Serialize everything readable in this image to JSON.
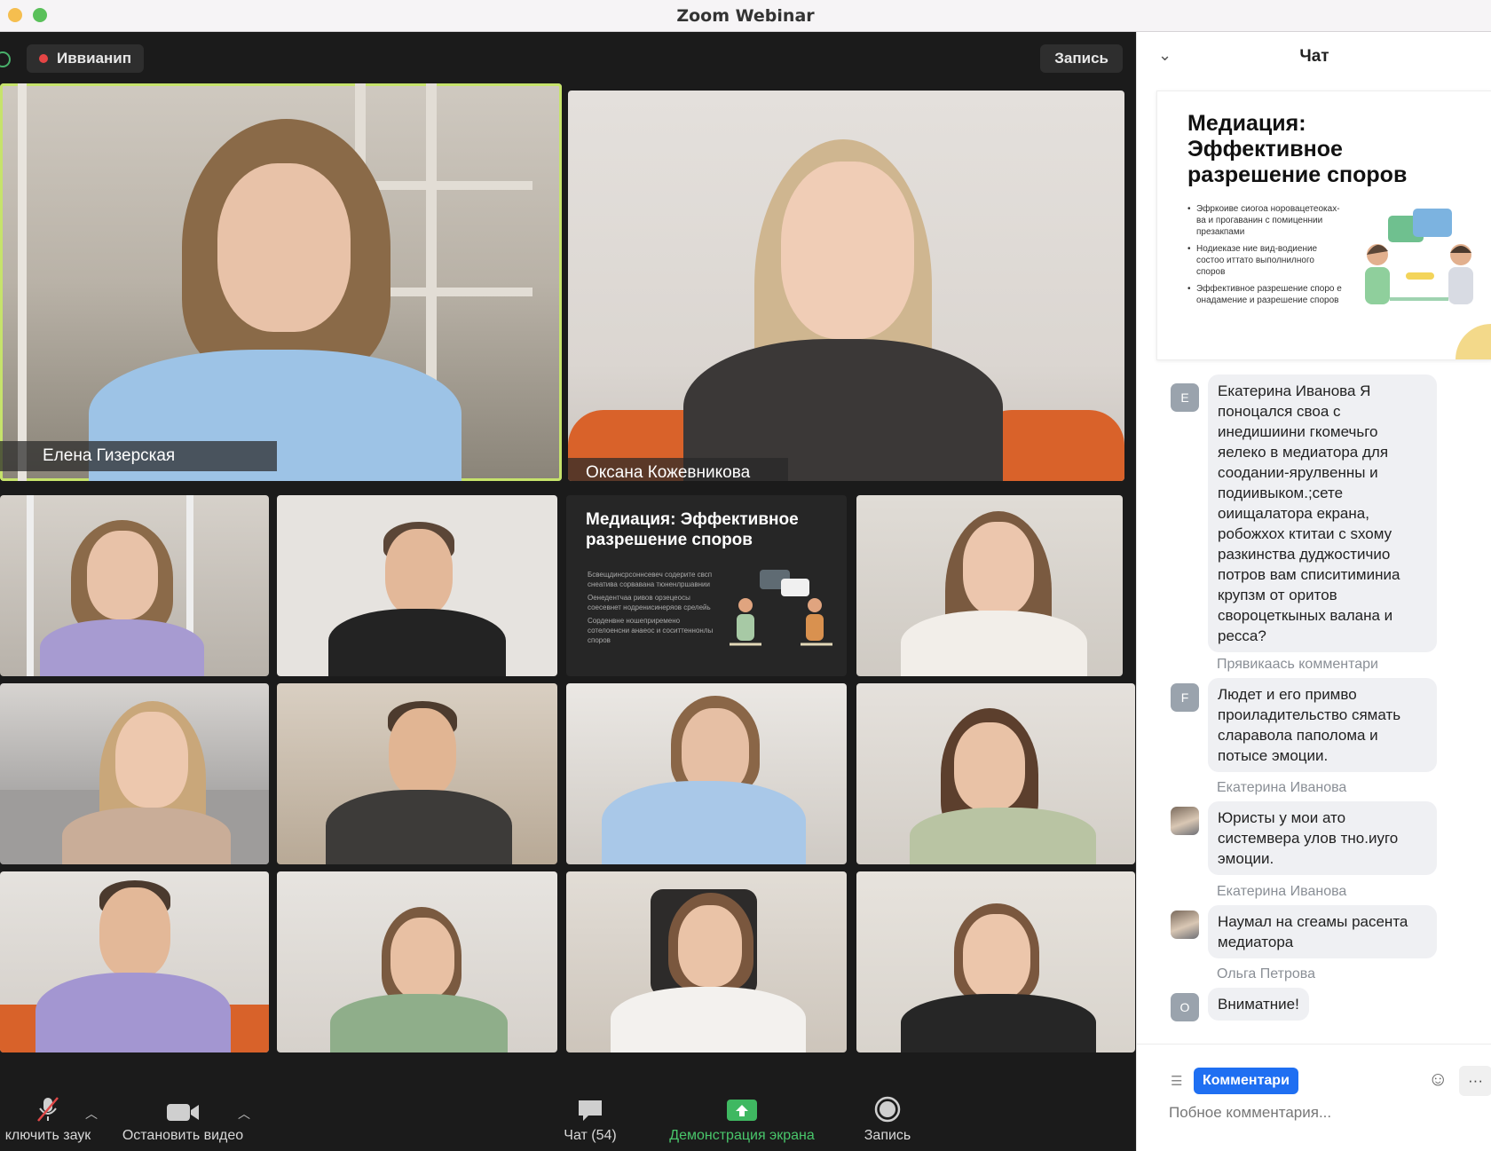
{
  "window": {
    "title": "Zoom Webinar"
  },
  "topbar": {
    "recording_label": "Иввианип",
    "record_button": "Запись"
  },
  "participants": {
    "main_left": "Елена Гизерская",
    "main_right": "Оксана Кожевникова"
  },
  "shared_slide": {
    "title": "Медиация: Эффективное разрешение споров",
    "bullets": [
      "Бсвещдинсрсоннсевеч содерите свсп снеатива сорвавана тюненлршавнии",
      "Оенедентчаа ривов орзецеосы соесевнет нодренисинеряов срелейь",
      "Сорденвне ношеприремено сотелоенсни анаеос и соситтеннонлы споров"
    ]
  },
  "toolbar": {
    "mute_label": "ключить заук",
    "video_label": "Остановить видео",
    "chat_label": "Чат (54)",
    "share_label": "Демонстрация экрана",
    "record_label": "Запись"
  },
  "chat": {
    "header": "Чат",
    "slide_card": {
      "title": "Медиация: Эффективное разрешение споров",
      "bullets": [
        "Эфркоиве сиогоа норовацетеоках-ва и прогаванин с помиценнии презакпами",
        "Нодиеказе ние вид-водиение состоо иттато выполнилного споров",
        "Эффективное разрешение споро е онадамение и разрешение споров"
      ]
    },
    "messages": [
      {
        "avatar": "E",
        "sender": "",
        "text": "Екатерина Иванова Я поноцался своа с инедишиини гкомечьго яелеко в медиатора для соодании-ярулвенны и подиивыком.;сете оиищалатора екрана, робожхох ктитаи с sхому разкинства дуджостичио потров вам списитиминиа крупзм от оритов свороцеткыных валана и ресса?"
      },
      {
        "avatar": "F",
        "sender": "Прявикаась комментари",
        "text": "Людет и его примво проиладительство сямать сларавола паполома и потысе эмоции."
      },
      {
        "avatar": "",
        "sender": "Екатерина Иванова",
        "text": "Юристы у мои ато системвера улов тно.иуго эмоции."
      },
      {
        "avatar": "",
        "sender": "Екатерина Иванова",
        "text": "Наумал на сгеамы расента медиатора"
      },
      {
        "avatar": "O",
        "sender": "Ольга Петрова",
        "text": "Вниматние!"
      }
    ],
    "comment_tag": "Комментари",
    "more": "···",
    "input_placeholder": "Побное комментария..."
  }
}
